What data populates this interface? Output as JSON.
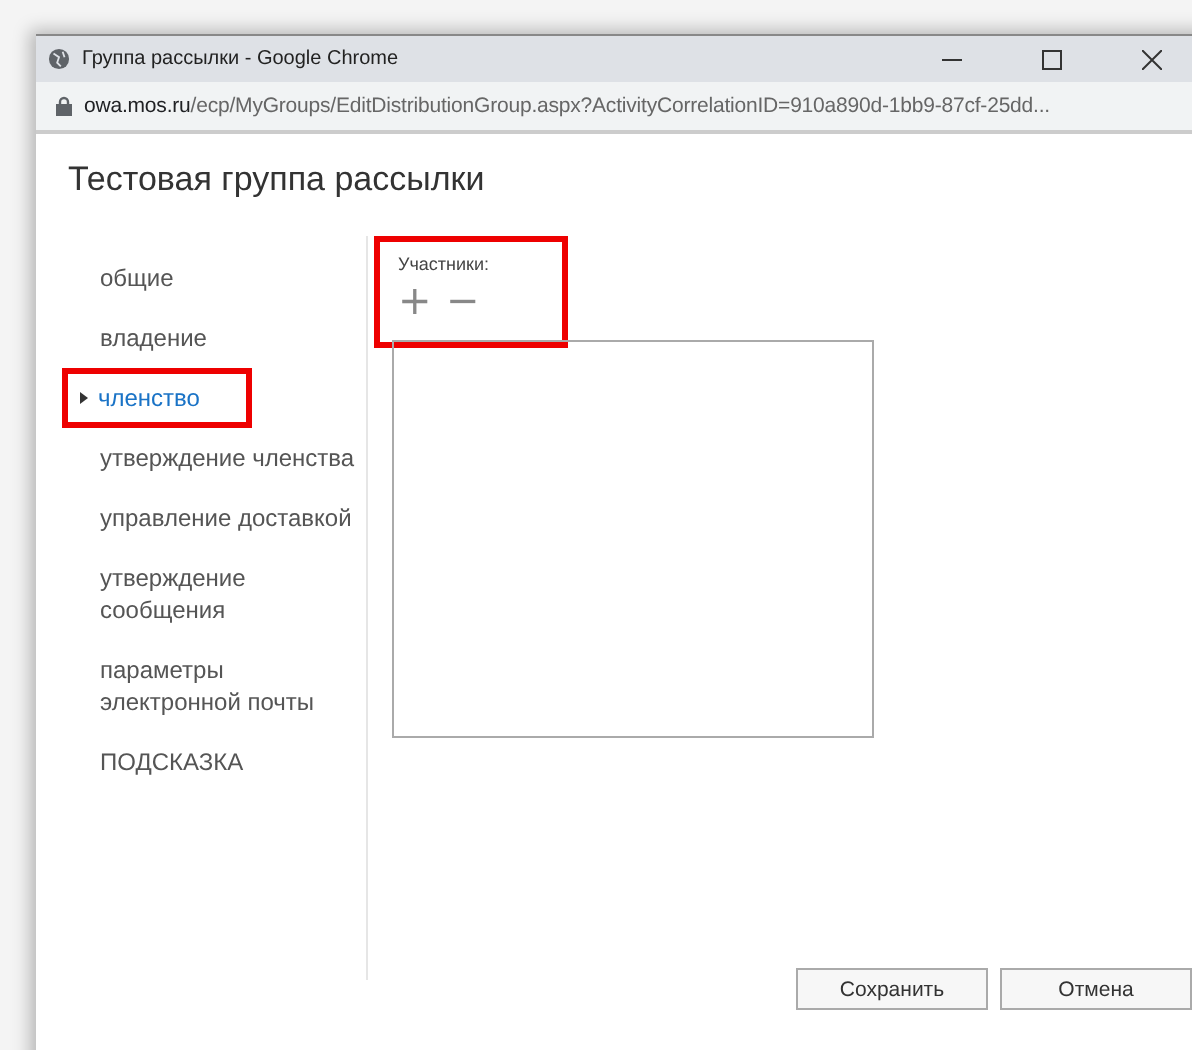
{
  "window": {
    "title": "Группа рассылки - Google Chrome"
  },
  "address_bar": {
    "host": "owa.mos.ru",
    "path": "/ecp/MyGroups/EditDistributionGroup.aspx?ActivityCorrelationID=910a890d-1bb9-87cf-25dd..."
  },
  "page_title": "Тестовая группа рассылки",
  "sidebar": {
    "items": [
      {
        "label": "общие",
        "selected": false,
        "highlighted": false
      },
      {
        "label": "владение",
        "selected": false,
        "highlighted": false
      },
      {
        "label": "членство",
        "selected": true,
        "highlighted": true
      },
      {
        "label": "утверждение членства",
        "selected": false,
        "highlighted": false
      },
      {
        "label": "управление доставкой",
        "selected": false,
        "highlighted": false
      },
      {
        "label": "утверждение сообщения",
        "selected": false,
        "highlighted": false
      },
      {
        "label": "параметры электронной почты",
        "selected": false,
        "highlighted": false
      },
      {
        "label": "ПОДСКАЗКА",
        "selected": false,
        "highlighted": false
      }
    ]
  },
  "members": {
    "label": "Участники:",
    "highlighted": true,
    "add_button": "+",
    "remove_button": "−"
  },
  "buttons": [
    "Сохранить",
    "Отмена"
  ]
}
